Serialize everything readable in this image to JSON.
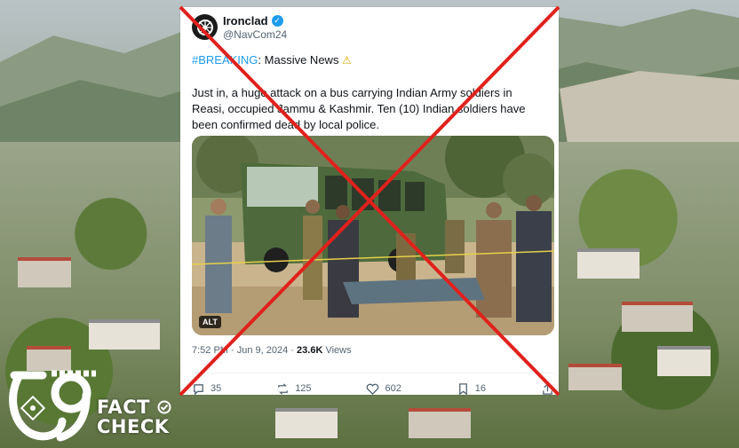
{
  "tweet": {
    "display_name": "Ironclad",
    "handle": "@NavCom24",
    "hashtag": "#BREAKING",
    "headline_rest": ": Massive News",
    "body": "Just in, a huge attack on a bus carrying Indian Army soldiers in Reasi, occupied Jammu & Kashmir. Ten (10) Indian soldiers have been confirmed dead by local police.",
    "image_alt_badge": "ALT",
    "time": "7:52 PM",
    "date": "Jun 9, 2024",
    "views_count": "23.6K",
    "views_label": "Views",
    "replies": "35",
    "reposts": "125",
    "likes": "602",
    "bookmarks": "16"
  },
  "logo": {
    "word1": "FACT",
    "word2": "CHECK"
  },
  "colors": {
    "cross": "#e0211c",
    "verified": "#1d9bf0",
    "hashtag": "#1d9bf0"
  }
}
